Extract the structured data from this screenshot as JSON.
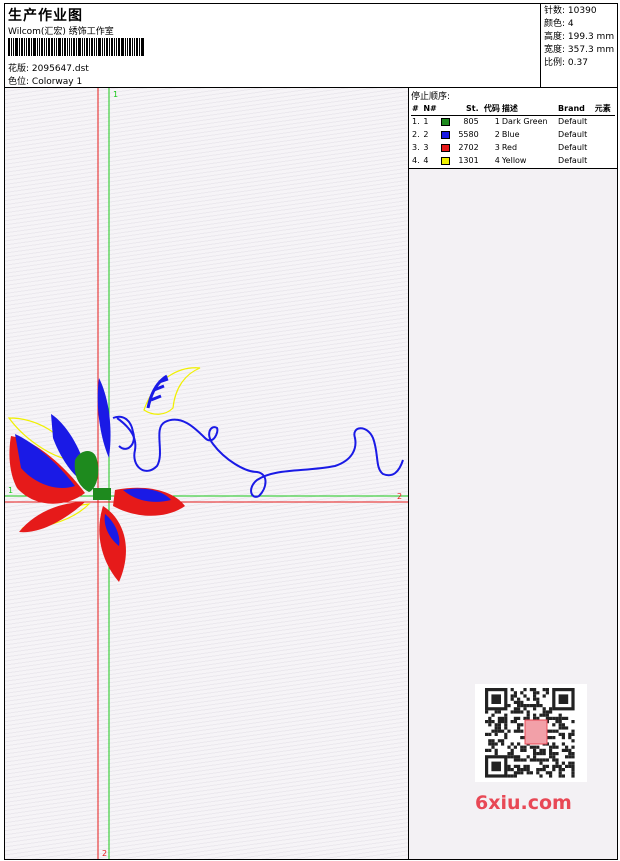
{
  "header": {
    "title": "生产作业图",
    "subtitle": "Wilcom(汇宏) 绣饰工作室",
    "design_label": "花版:",
    "design_value": "2095647.dst",
    "colorway_label": "色位:",
    "colorway_value": "Colorway 1"
  },
  "stats": {
    "stitches_label": "针数:",
    "stitches_value": "10390",
    "colors_label": "颜色:",
    "colors_value": "4",
    "height_label": "高度:",
    "height_value": "199.3 mm",
    "width_label": "宽度:",
    "width_value": "357.3 mm",
    "scale_label": "比例:",
    "scale_value": "0.37"
  },
  "stop_sequence": {
    "title": "停止顺序:",
    "headers": [
      "#",
      "N#",
      "St.",
      "代码",
      "描述",
      "Brand",
      "元素"
    ],
    "rows": [
      {
        "index": "1.",
        "n": "1",
        "color": "#1e8a1e",
        "st": "805",
        "code": "1",
        "desc": "Dark Green",
        "brand": "Default"
      },
      {
        "index": "2.",
        "n": "2",
        "color": "#1a1ae6",
        "st": "5580",
        "code": "2",
        "desc": "Blue",
        "brand": "Default"
      },
      {
        "index": "3.",
        "n": "3",
        "color": "#e61a1a",
        "st": "2702",
        "code": "3",
        "desc": "Red",
        "brand": "Default"
      },
      {
        "index": "4.",
        "n": "4",
        "color": "#f0f000",
        "st": "1301",
        "code": "4",
        "desc": "Yellow",
        "brand": "Default"
      }
    ]
  },
  "canvas": {
    "axis_v_top": "1",
    "axis_v_bottom": "2",
    "axis_h_left": "1",
    "axis_h_right": "2",
    "guide_green": "#19c819",
    "guide_red": "#e61a1a"
  },
  "watermark": {
    "text": "6xiu.com",
    "stamp": "设计图库"
  }
}
